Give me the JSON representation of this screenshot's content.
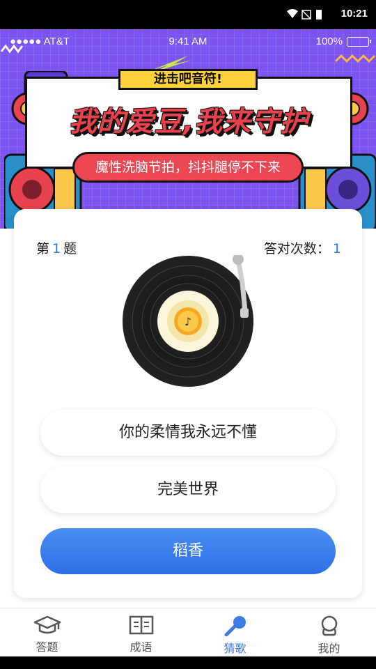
{
  "system_status": {
    "time": "10:21"
  },
  "ios_status": {
    "carrier": "●●●●● AT&T",
    "time": "9:41 AM",
    "battery": "100%"
  },
  "banner": {
    "tag": "进击吧音符!",
    "headline": "我的爱豆,我来守护",
    "subtitle": "魔性洗脑节拍，抖抖腿停不下来"
  },
  "question": {
    "prefix": "第",
    "number": "1",
    "suffix": "题",
    "correct_label": "答对次数：",
    "correct_count": "1"
  },
  "options": [
    {
      "label": "你的柔情我永远不懂"
    },
    {
      "label": "完美世界"
    },
    {
      "label": "稻香"
    }
  ],
  "nav": [
    {
      "label": "答题",
      "icon": "graduation-cap-icon"
    },
    {
      "label": "成语",
      "icon": "book-icon"
    },
    {
      "label": "猜歌",
      "icon": "microphone-icon",
      "active": true
    },
    {
      "label": "我的",
      "icon": "user-icon"
    }
  ],
  "colors": {
    "accent": "#3c7ae6",
    "banner": "#7c52f0",
    "headline": "#e8424e",
    "tag": "#ffd23a"
  }
}
